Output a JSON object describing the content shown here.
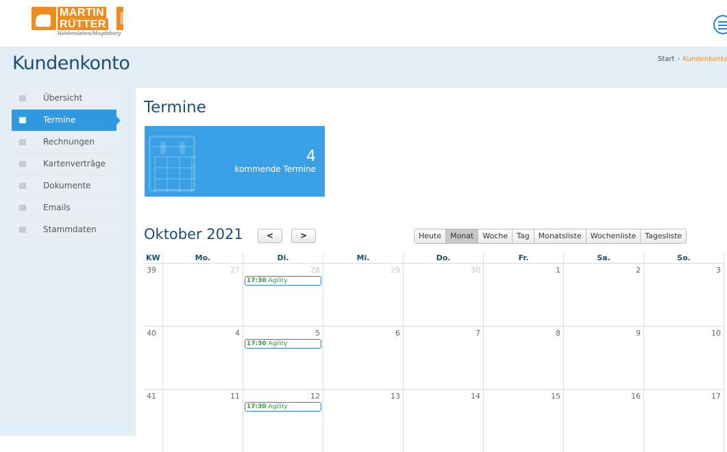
{
  "header": {
    "logo_line1": "MARTIN",
    "logo_line2": "RÜTTER",
    "logo_dogs": "DOGS",
    "logo_sub": "Haldensleben/Magdeburg"
  },
  "title_band": {
    "title": "Kundenkonto",
    "breadcrumb": {
      "start": "Start",
      "separator": "›",
      "current": "Kundenkonto"
    }
  },
  "sidebar": {
    "items": [
      {
        "label": "Übersicht",
        "icon": "home-icon",
        "active": false
      },
      {
        "label": "Termine",
        "icon": "calendar-icon",
        "active": true
      },
      {
        "label": "Rechnungen",
        "icon": "cart-icon",
        "active": false
      },
      {
        "label": "Kartenverträge",
        "icon": "file-icon",
        "active": false
      },
      {
        "label": "Dokumente",
        "icon": "download-icon",
        "active": false
      },
      {
        "label": "Emails",
        "icon": "envelope-icon",
        "active": false
      },
      {
        "label": "Stammdaten",
        "icon": "gear-icon",
        "active": false
      }
    ]
  },
  "main": {
    "title": "Termine",
    "tile": {
      "count": "4",
      "label": "kommende Termine"
    }
  },
  "calendar": {
    "month_title": "Oktober 2021",
    "prev_label": "<",
    "next_label": ">",
    "views": [
      {
        "label": "Heute",
        "active": false
      },
      {
        "label": "Monat",
        "active": true
      },
      {
        "label": "Woche",
        "active": false
      },
      {
        "label": "Tag",
        "active": false
      },
      {
        "label": "Monatsliste",
        "active": false
      },
      {
        "label": "Wochenliste",
        "active": false
      },
      {
        "label": "Tagesliste",
        "active": false
      }
    ],
    "columns": [
      "KW",
      "Mo.",
      "Di.",
      "Mi.",
      "Do.",
      "Fr.",
      "Sa.",
      "So."
    ],
    "weeks": [
      {
        "kw": "39",
        "days": [
          {
            "d": "27",
            "other": true
          },
          {
            "d": "28",
            "other": true,
            "event": {
              "time": "17:30",
              "title": "Agility"
            }
          },
          {
            "d": "29",
            "other": true
          },
          {
            "d": "30",
            "other": true
          },
          {
            "d": "1",
            "other": false
          },
          {
            "d": "2",
            "other": false
          },
          {
            "d": "3",
            "other": false
          }
        ]
      },
      {
        "kw": "40",
        "days": [
          {
            "d": "4",
            "other": false
          },
          {
            "d": "5",
            "other": false,
            "event": {
              "time": "17:30",
              "title": "Agility"
            }
          },
          {
            "d": "6",
            "other": false
          },
          {
            "d": "7",
            "other": false
          },
          {
            "d": "8",
            "other": false
          },
          {
            "d": "9",
            "other": false
          },
          {
            "d": "10",
            "other": false
          }
        ]
      },
      {
        "kw": "41",
        "days": [
          {
            "d": "11",
            "other": false
          },
          {
            "d": "12",
            "other": false,
            "event": {
              "time": "17:30",
              "title": "Agility"
            }
          },
          {
            "d": "13",
            "other": false
          },
          {
            "d": "14",
            "other": false
          },
          {
            "d": "15",
            "other": false
          },
          {
            "d": "16",
            "other": false
          },
          {
            "d": "17",
            "other": false
          }
        ]
      }
    ]
  },
  "colors": {
    "accent": "#2f9ae0",
    "brand_orange": "#f08c1e",
    "title_blue": "#1b4f72",
    "event_green": "#2a9d34"
  }
}
